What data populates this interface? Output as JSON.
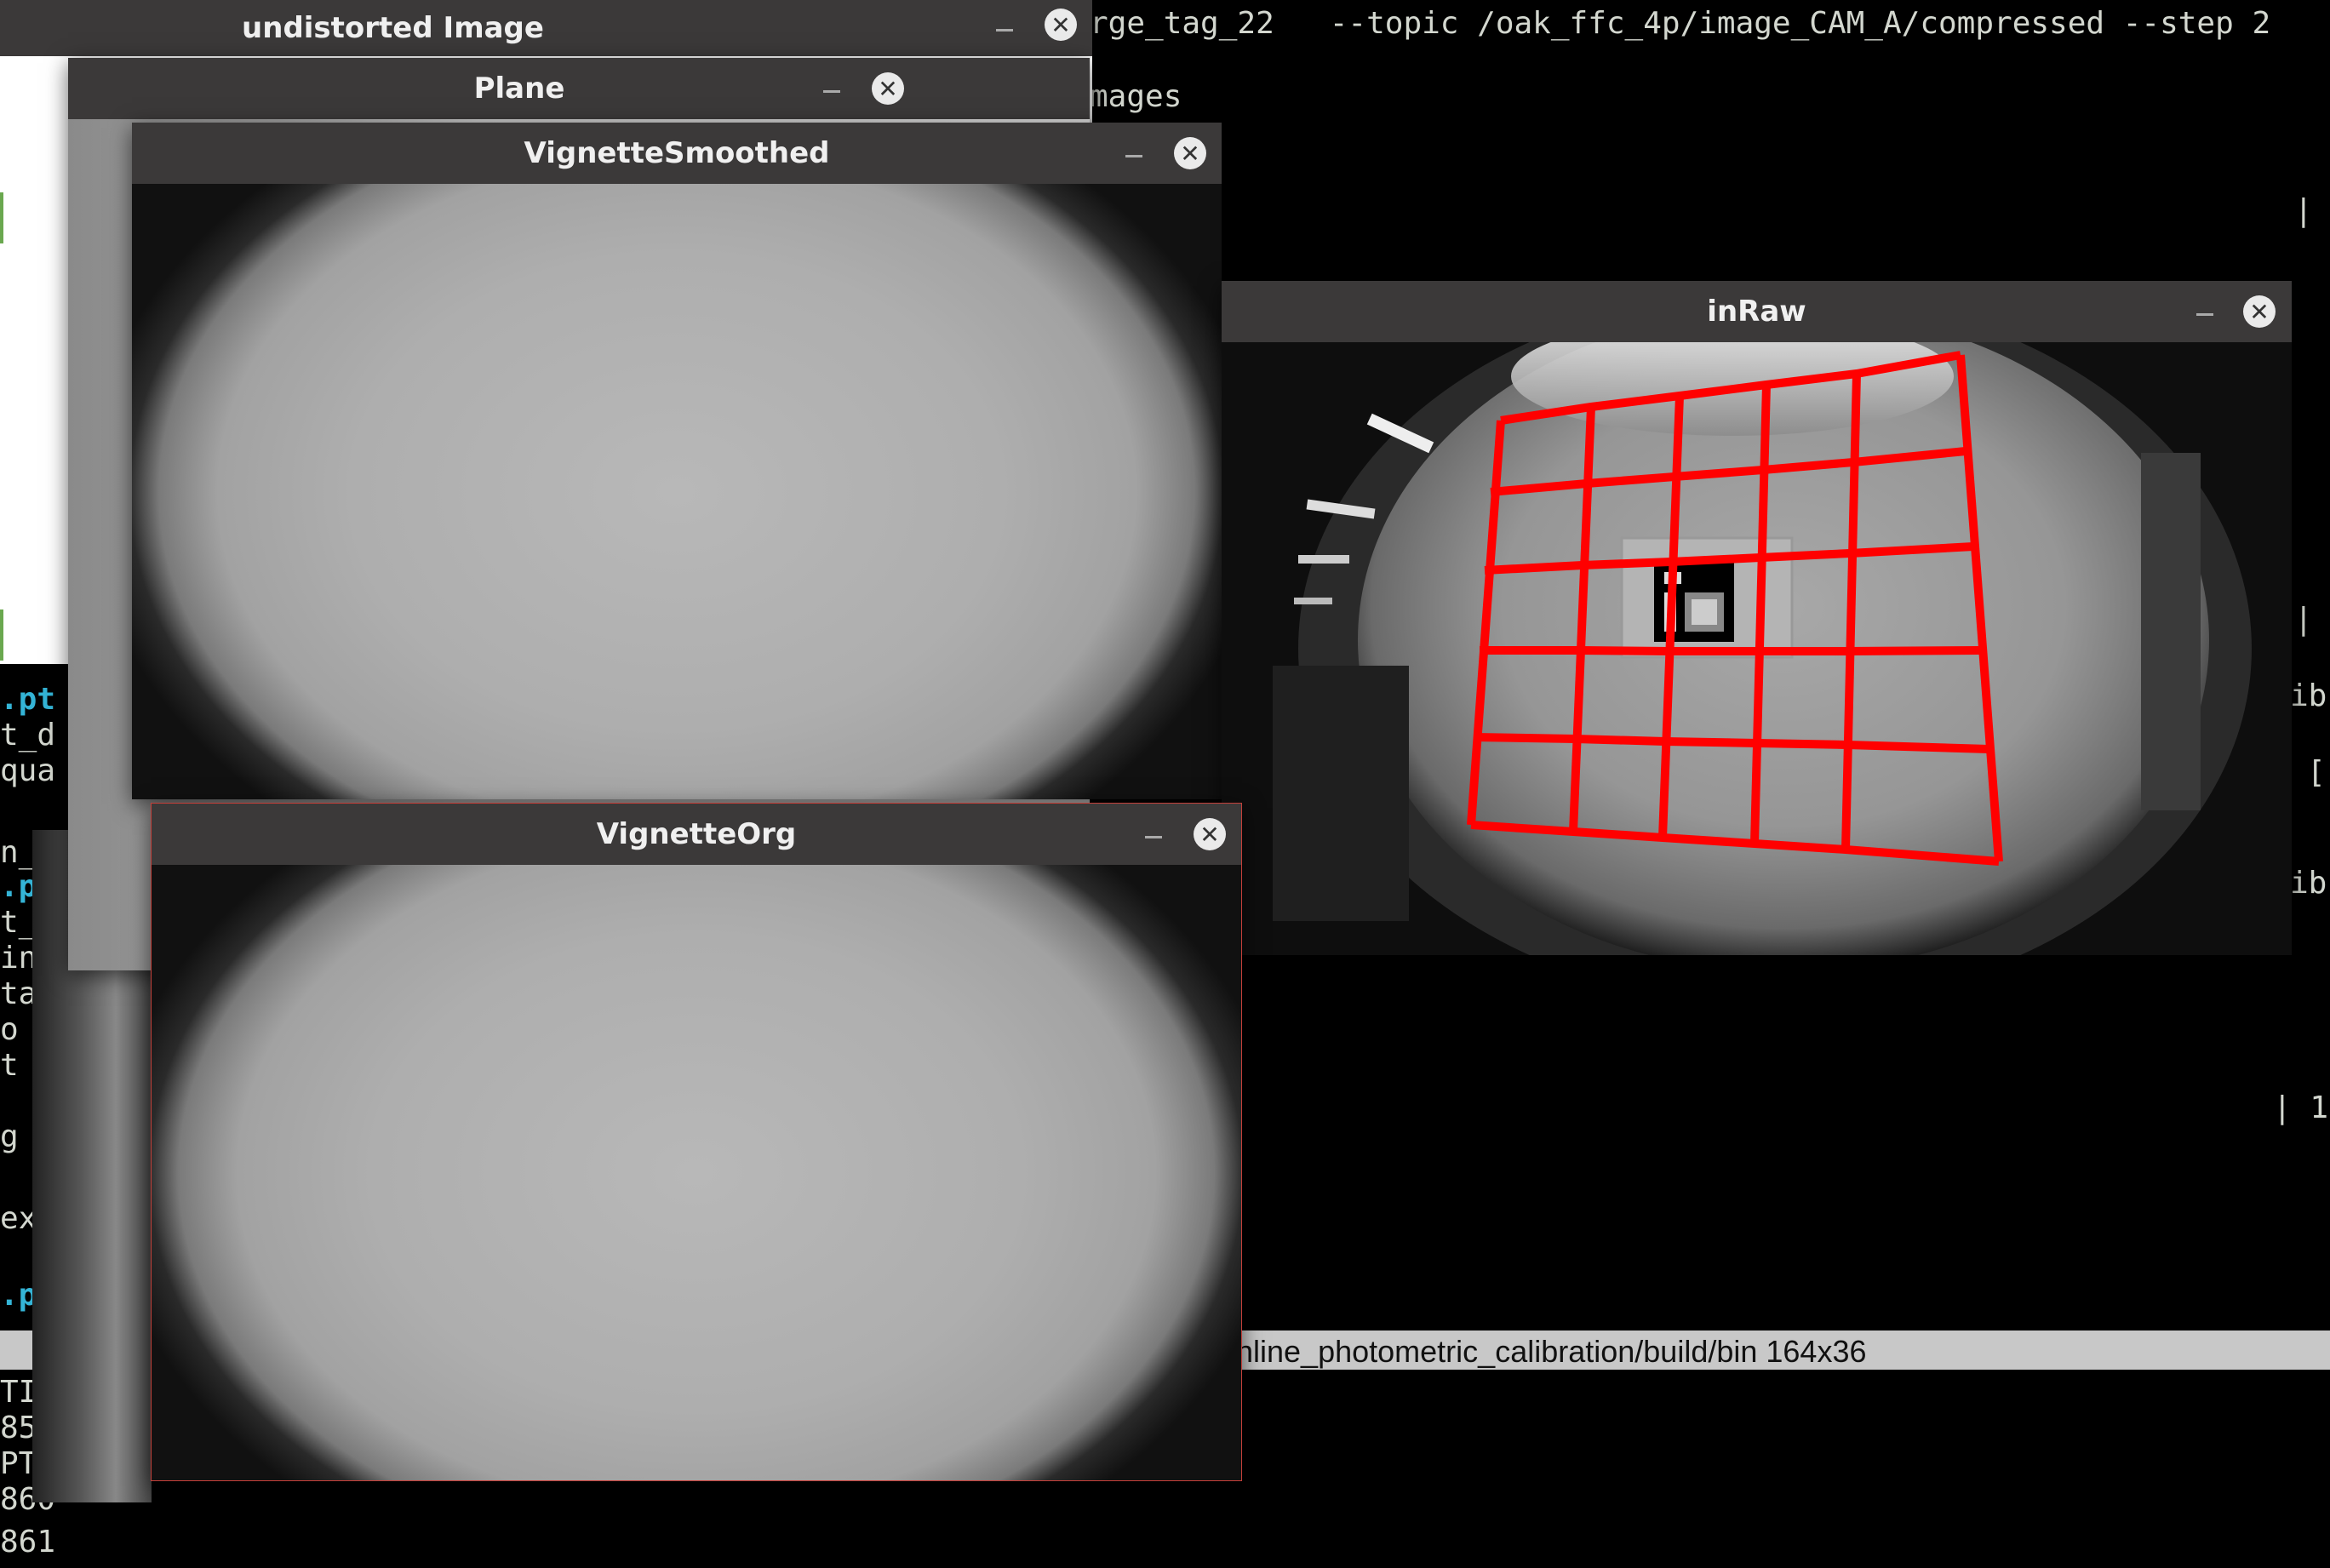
{
  "terminal": {
    "line1": "rge_tag_22   --topic /oak_ffc_4p/image_CAM_A/compressed --step 2",
    "line2": "mages",
    "left_fragments": [
      "pt",
      "t_d",
      "qua",
      "n_i",
      "pt",
      "t_",
      "in",
      "ta",
      "o",
      "t a",
      "g i",
      "ex",
      "pt",
      "TI",
      "85",
      "PT",
      "860",
      "861"
    ],
    "right_fragments": [
      "|",
      "|",
      "ib",
      "[",
      "ib",
      "| 1"
    ],
    "cyan_prefixes": [
      ".pt",
      ".pt",
      ".pt"
    ]
  },
  "status_bar": {
    "text": "nline_photometric_calibration/build/bin 164x36"
  },
  "windows": {
    "undistorted": {
      "title": "undistorted Image"
    },
    "plane": {
      "title": "Plane"
    },
    "vignette_smoothed": {
      "title": "VignetteSmoothed"
    },
    "vignette_org": {
      "title": "VignetteOrg"
    },
    "in_raw": {
      "title": "inRaw"
    }
  },
  "icons": {
    "minimize": "minimize-icon",
    "close": "close-icon",
    "close_glyph": "✕",
    "min_glyph": "–"
  },
  "colors": {
    "titlebar": "#3b3939",
    "grid": "#ff0000",
    "terminal_text": "#d3d7cf",
    "cyan": "#34b4d6"
  }
}
